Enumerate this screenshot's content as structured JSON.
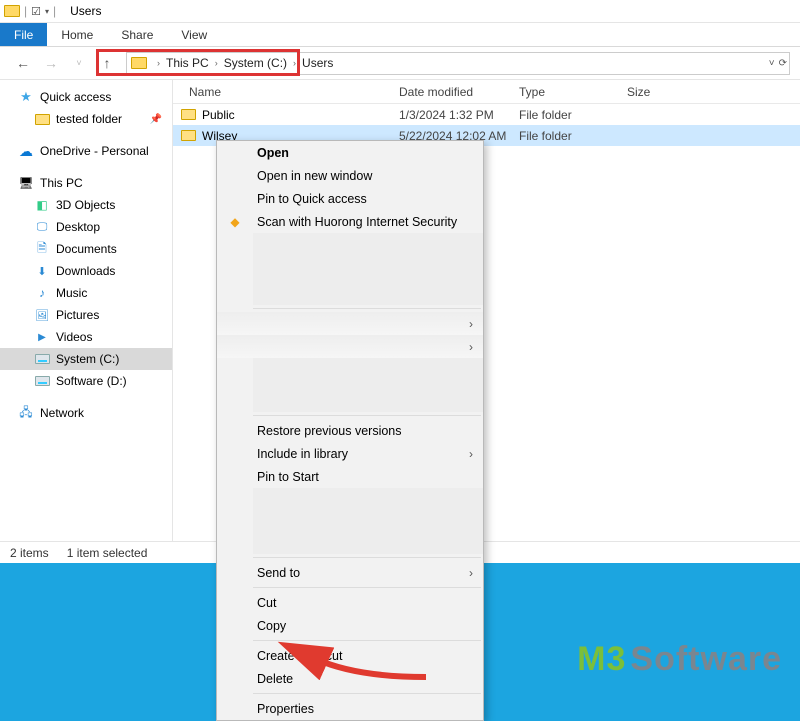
{
  "window": {
    "title": "Users"
  },
  "ribbon": {
    "file": "File",
    "home": "Home",
    "share": "Share",
    "view": "View"
  },
  "breadcrumb": {
    "pc": "This PC",
    "drive": "System (C:)",
    "folder": "Users"
  },
  "sidebar": {
    "quick": "Quick access",
    "tested": "tested folder",
    "onedrive": "OneDrive - Personal",
    "thispc": "This PC",
    "obj3d": "3D Objects",
    "desktop": "Desktop",
    "documents": "Documents",
    "downloads": "Downloads",
    "music": "Music",
    "pictures": "Pictures",
    "videos": "Videos",
    "sysc": "System (C:)",
    "swd": "Software (D:)",
    "network": "Network"
  },
  "columns": {
    "name": "Name",
    "date": "Date modified",
    "type": "Type",
    "size": "Size"
  },
  "rows": [
    {
      "name": "Public",
      "date": "1/3/2024 1:32 PM",
      "type": "File folder"
    },
    {
      "name": "Wilsey",
      "date": "5/22/2024 12:02 AM",
      "type": "File folder"
    }
  ],
  "status": {
    "items": "2 items",
    "selected": "1 item selected"
  },
  "context": {
    "open": "Open",
    "open_new": "Open in new window",
    "pin_quick": "Pin to Quick access",
    "huorong": "Scan with Huorong Internet Security",
    "restore": "Restore previous versions",
    "include_lib": "Include in library",
    "pin_start": "Pin to Start",
    "send_to": "Send to",
    "cut": "Cut",
    "copy": "Copy",
    "create_shortcut": "Create shortcut",
    "delete": "Delete",
    "properties": "Properties"
  },
  "watermark": {
    "m3": "M3",
    "rest": "Software"
  }
}
